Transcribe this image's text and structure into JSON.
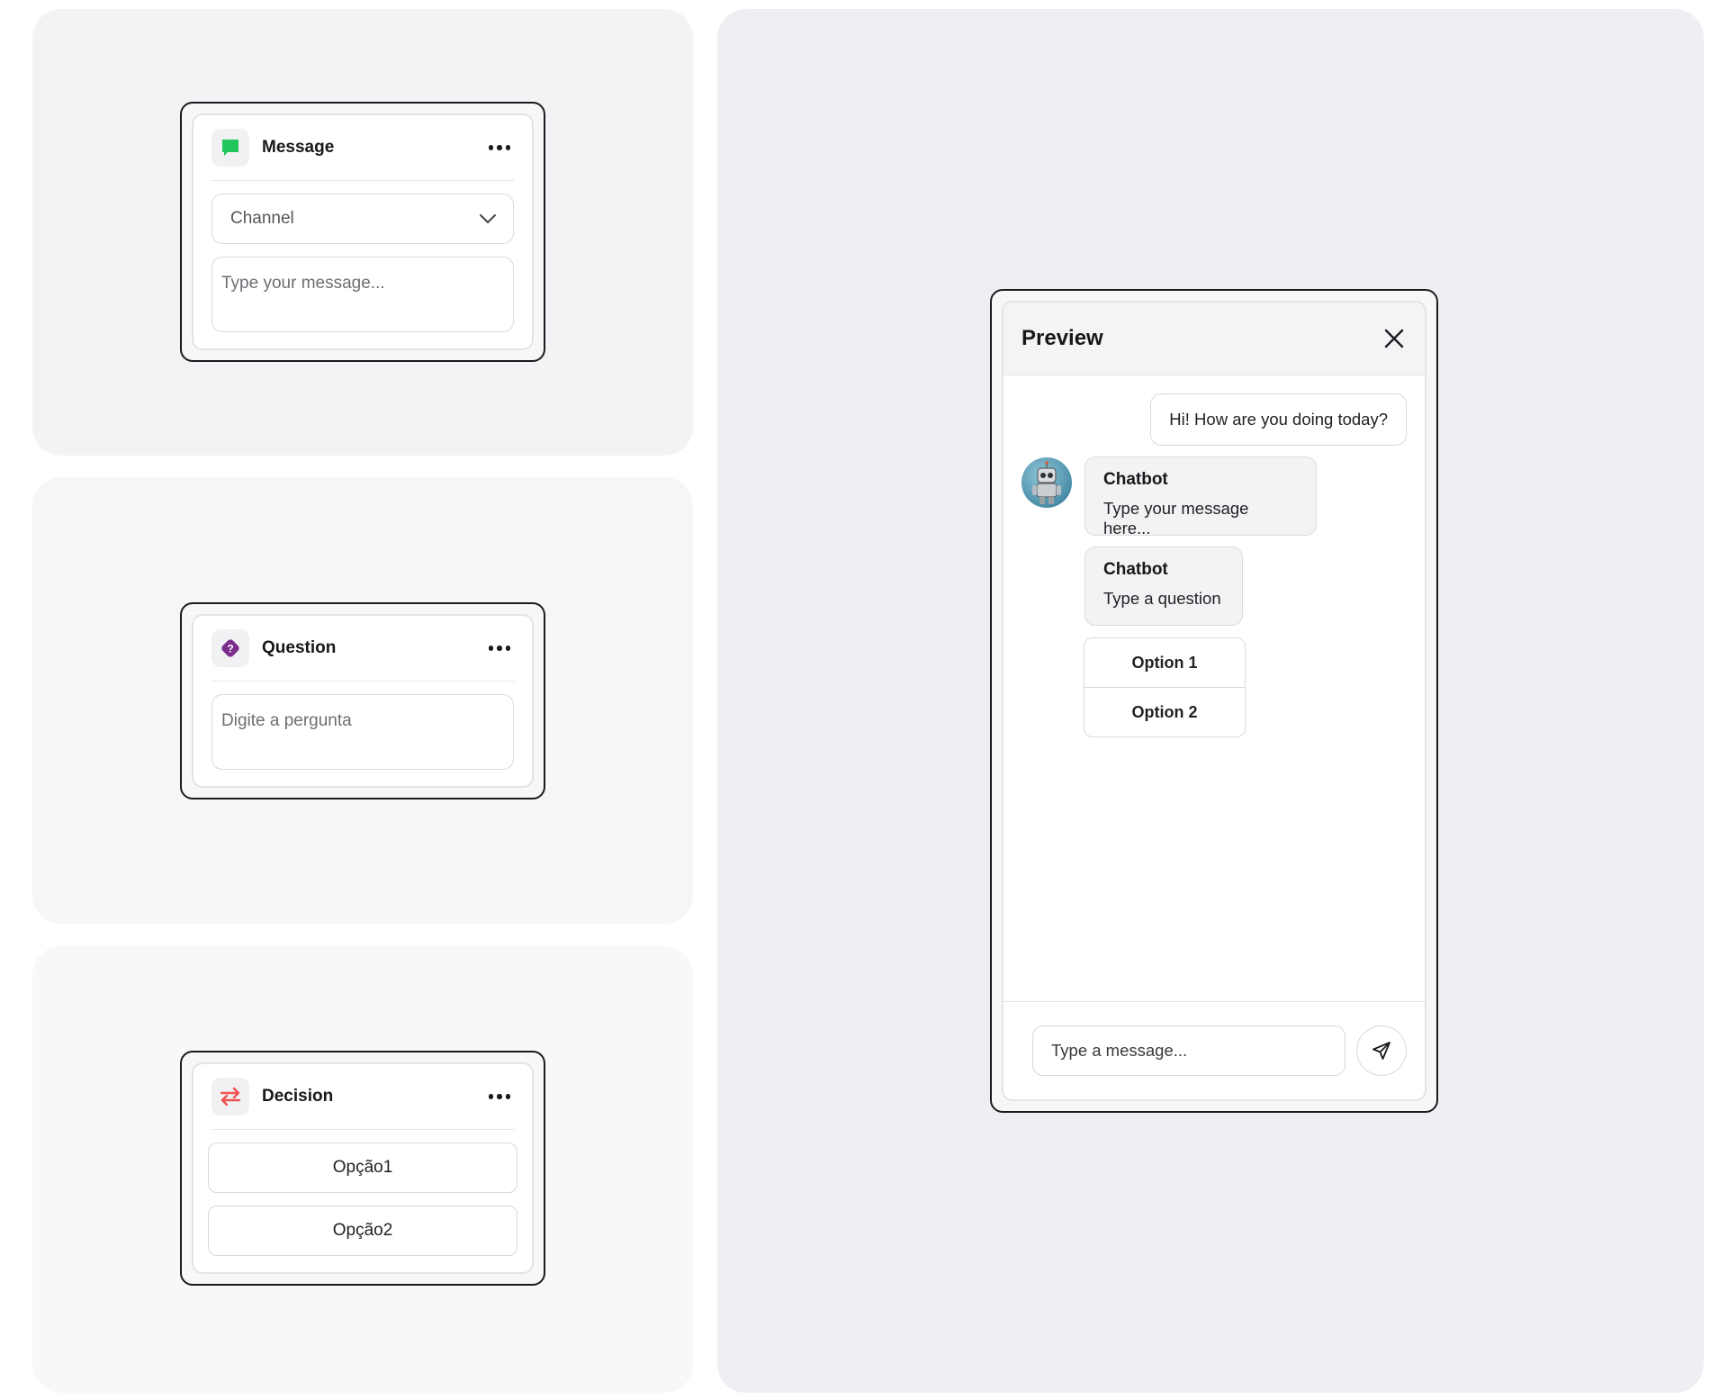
{
  "message_node": {
    "title": "Message",
    "channel_placeholder": "Channel",
    "message_placeholder": "Type your message..."
  },
  "question_node": {
    "title": "Question",
    "question_placeholder": "Digite a pergunta"
  },
  "decision_node": {
    "title": "Decision",
    "options": [
      "Opção1",
      "Opção2"
    ]
  },
  "preview": {
    "title": "Preview",
    "user_message": "Hi! How are you doing today?",
    "bot_messages": [
      {
        "name": "Chatbot",
        "text": "Type your message here..."
      },
      {
        "name": "Chatbot",
        "text": "Type a question"
      }
    ],
    "options": [
      "Option 1",
      "Option 2"
    ],
    "composer_placeholder": "Type a message..."
  },
  "icons": {
    "message": "chat-bubble-icon",
    "question": "question-diamond-icon",
    "decision": "swap-arrows-icon",
    "more": "more-horizontal-icon",
    "close": "close-icon",
    "send": "send-icon",
    "chevron": "chevron-down-icon"
  },
  "colors": {
    "message_accent": "#22c55e",
    "question_accent": "#7b2d8e",
    "decision_accent": "#ef5350"
  }
}
